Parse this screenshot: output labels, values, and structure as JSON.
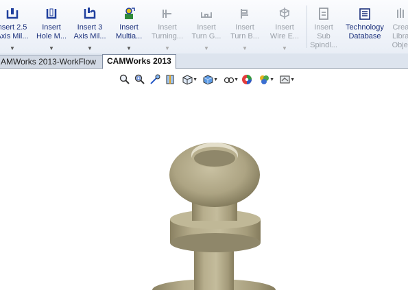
{
  "ribbon": {
    "buttons": [
      {
        "line1": "nsert 2.5",
        "line2": "Axis Mil...",
        "enabled": true,
        "icon": "mill-2-5-axis-icon"
      },
      {
        "line1": "Insert",
        "line2": "Hole M...",
        "enabled": true,
        "icon": "hole-machining-icon"
      },
      {
        "line1": "Insert 3",
        "line2": "Axis Mil...",
        "enabled": true,
        "icon": "mill-3-axis-icon"
      },
      {
        "line1": "Insert",
        "line2": "Multia...",
        "enabled": true,
        "icon": "multiaxis-icon"
      },
      {
        "line1": "Insert",
        "line2": "Turning...",
        "enabled": false,
        "icon": "turning-icon"
      },
      {
        "line1": "Insert",
        "line2": "Turn G...",
        "enabled": false,
        "icon": "turn-groove-icon"
      },
      {
        "line1": "Insert",
        "line2": "Turn B...",
        "enabled": false,
        "icon": "turn-bore-icon"
      },
      {
        "line1": "Insert",
        "line2": "Wire E...",
        "enabled": false,
        "icon": "wire-edm-icon"
      }
    ],
    "insert_sub_spindle": {
      "line1": "Insert",
      "line2": "Sub",
      "line3": "Spindl..."
    },
    "technology_database": {
      "line1": "Technology",
      "line2": "Database"
    },
    "create_library_object": {
      "line1": "Creat",
      "line2": "Librar",
      "line3": "Objec"
    }
  },
  "tabs": {
    "workflow": "AMWorks 2013-WorkFlow",
    "camworks": "CAMWorks 2013"
  },
  "view_toolbar": [
    "zoom-to-fit-icon",
    "zoom-to-area-icon",
    "previous-view-icon",
    "section-view-icon",
    "view-orientation-icon",
    "display-style-icon",
    "hide-show-items-icon",
    "edit-appearance-icon",
    "apply-scene-icon",
    "view-settings-icon"
  ],
  "colors": {
    "enabled_label": "#1a2f7a",
    "disabled_label": "#9aa0a8",
    "part_body": "#b9b08f",
    "tab_bar": "#dde4ee"
  }
}
